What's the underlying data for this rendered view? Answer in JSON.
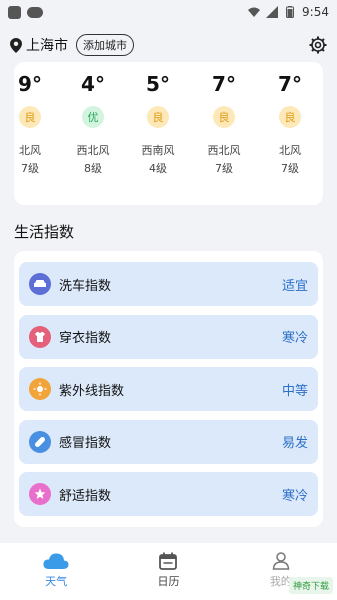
{
  "status_bar": {
    "time": "9:54"
  },
  "header": {
    "city": "上海市",
    "add_city": "添加城市"
  },
  "forecast": [
    {
      "temp": "9°",
      "aqi": "良",
      "wind_dir": "北风",
      "wind_level": "7级"
    },
    {
      "temp": "4°",
      "aqi": "优",
      "wind_dir": "西北风",
      "wind_level": "8级"
    },
    {
      "temp": "5°",
      "aqi": "良",
      "wind_dir": "西南风",
      "wind_level": "4级"
    },
    {
      "temp": "7°",
      "aqi": "良",
      "wind_dir": "西北风",
      "wind_level": "7级"
    },
    {
      "temp": "7°",
      "aqi": "良",
      "wind_dir": "北风",
      "wind_level": "7级"
    }
  ],
  "index_section": {
    "title": "生活指数",
    "items": [
      {
        "label": "洗车指数",
        "value": "适宜",
        "icon": "car-icon",
        "color": "#5b6fd6"
      },
      {
        "label": "穿衣指数",
        "value": "寒冷",
        "icon": "shirt-icon",
        "color": "#e5607a"
      },
      {
        "label": "紫外线指数",
        "value": "中等",
        "icon": "sun-icon",
        "color": "#f2a33a"
      },
      {
        "label": "感冒指数",
        "value": "易发",
        "icon": "pill-icon",
        "color": "#4a90e2"
      },
      {
        "label": "舒适指数",
        "value": "寒冷",
        "icon": "star-icon",
        "color": "#e86fcb"
      }
    ]
  },
  "nav": {
    "weather": "天气",
    "calendar": "日历",
    "mine": "我的"
  },
  "watermark": "神奇下载"
}
